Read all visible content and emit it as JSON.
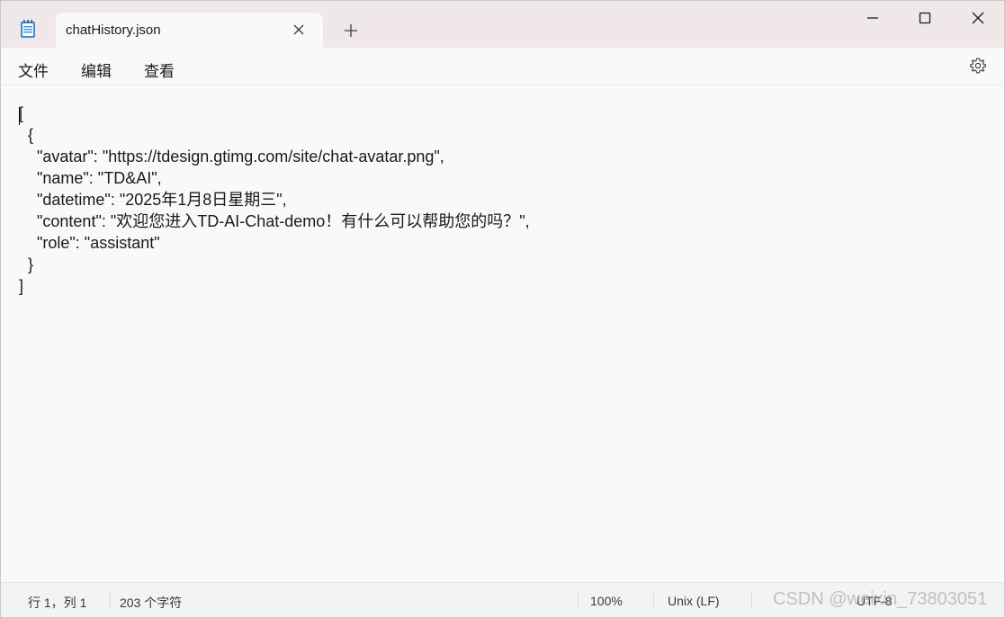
{
  "titlebar": {
    "tab_title": "chatHistory.json",
    "icons": {
      "app": "notepad-icon",
      "tab_close": "close-icon",
      "new_tab": "plus-icon",
      "minimize": "minimize-icon",
      "maximize": "maximize-icon",
      "close": "close-icon"
    }
  },
  "menubar": {
    "file": "文件",
    "edit": "编辑",
    "view": "查看",
    "settings_icon": "gear-icon"
  },
  "editor": {
    "lines": [
      "[",
      "  {",
      "    \"avatar\": \"https://tdesign.gtimg.com/site/chat-avatar.png\",",
      "    \"name\": \"TD&AI\",",
      "    \"datetime\": \"2025年1月8日星期三\",",
      "    \"content\": \"欢迎您进入TD-AI-Chat-demo！有什么可以帮助您的吗？\",",
      "    \"role\": \"assistant\"",
      "  }",
      "]"
    ]
  },
  "statusbar": {
    "position": "行 1，列 1",
    "char_count": "203 个字符",
    "zoom": "100%",
    "line_ending": "Unix (LF)",
    "encoding": "UTF-8"
  },
  "watermark": "CSDN @weixin_73803051"
}
